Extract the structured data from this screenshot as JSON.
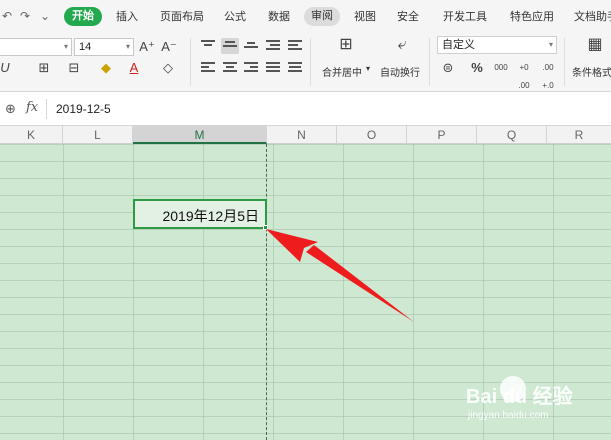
{
  "quick_access": {
    "undo_icon": "↶",
    "redo_icon": "↷",
    "customize_icon": "⌄"
  },
  "menu": {
    "tabs": [
      {
        "label": "开始",
        "active": true
      },
      {
        "label": "插入"
      },
      {
        "label": "页面布局"
      },
      {
        "label": "公式"
      },
      {
        "label": "数据"
      },
      {
        "label": "审阅",
        "highlighted": true
      },
      {
        "label": "视图"
      },
      {
        "label": "安全"
      },
      {
        "label": "开发工具"
      },
      {
        "label": "特色应用"
      },
      {
        "label": "文档助手"
      }
    ]
  },
  "ribbon": {
    "font_size": "14",
    "increase_font": "A⁺",
    "decrease_font": "A⁻",
    "merge_center_label": "合并居中",
    "wrap_text_label": "自动换行",
    "number_format": "自定义",
    "percent_symbol": "%",
    "thousands_label": "000",
    "inc_decimal_label": "+0 .00",
    "dec_decimal_label": ".00 +.0",
    "conditional_format_label": "条件格式",
    "italic_glyph": "U",
    "font_color_glyph": "A"
  },
  "formula_bar": {
    "fx_label": "fx",
    "value": "2019-12-5"
  },
  "columns": [
    "K",
    "L",
    "M",
    "N",
    "O",
    "P",
    "Q",
    "R"
  ],
  "selected_column": "M",
  "active_cell": {
    "display": "2019年12月5日"
  },
  "watermark": {
    "title": "Bai du 经验",
    "subtitle": "jingyan.baidu.com"
  },
  "colors": {
    "accent": "#22a94d",
    "grid_bg": "#cfe8d2",
    "arrow": "#ee1c1c"
  }
}
